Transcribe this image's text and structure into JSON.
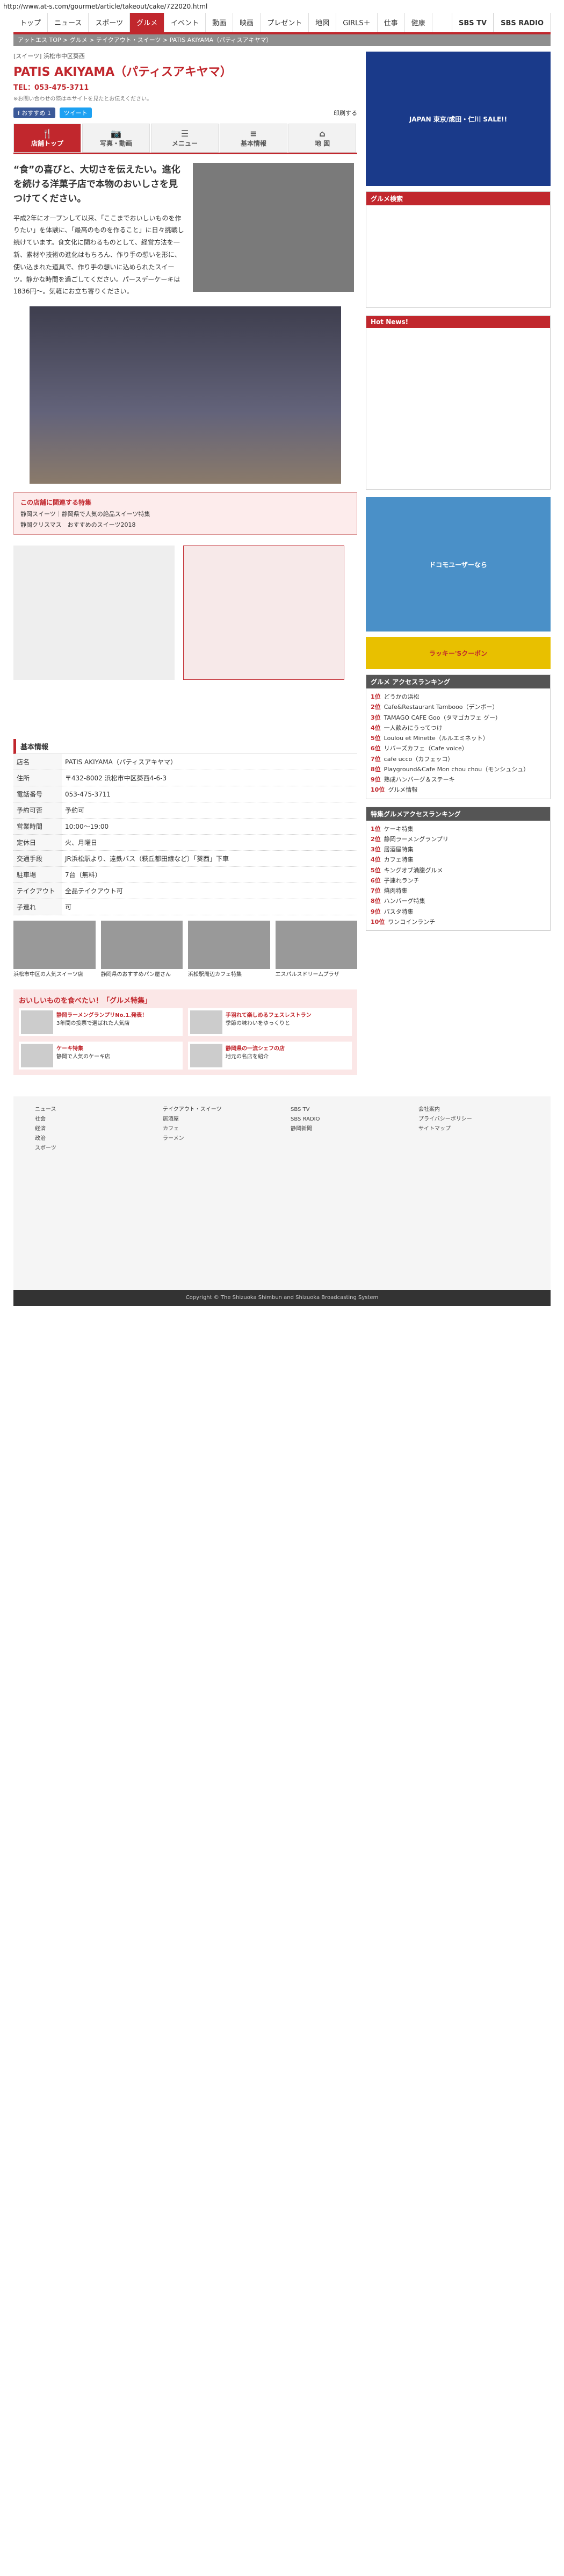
{
  "url": "http://www.at-s.com/gourmet/article/takeout/cake/722020.html",
  "nav": {
    "items": [
      "トップ",
      "ニュース",
      "スポーツ",
      "グルメ",
      "イベント",
      "動画",
      "映画",
      "プレゼント",
      "地図",
      "GIRLS＋",
      "仕事",
      "健康"
    ],
    "active": "グルメ",
    "right": [
      "SBS TV",
      "SBS RADIO"
    ]
  },
  "breadcrumb": "アットエス TOP > グルメ > テイクアウト・スイーツ > PATIS AKIYAMA（パティスアキヤマ）",
  "shop": {
    "area": "[スイーツ] 浜松市中区葵西",
    "title": "PATIS AKIYAMA（パティスアキヤマ）",
    "tel": "TEL：053-475-3711",
    "note": "※お問い合わせの際は本サイトを見たとお伝えください。"
  },
  "share": {
    "fb": "f おすすめ 1",
    "tw": "ツイート",
    "print": "印刷する"
  },
  "tabs": [
    {
      "icon": "fork",
      "label": "店舗トップ"
    },
    {
      "icon": "camera",
      "label": "写真・動画"
    },
    {
      "icon": "menu",
      "label": "メニュー"
    },
    {
      "icon": "list",
      "label": "基本情報"
    },
    {
      "icon": "map",
      "label": "地 図"
    }
  ],
  "intro": {
    "lead": "“食”の喜びと、大切さを伝えたい。進化を続ける洋菓子店で本物のおいしさを見つけてください。",
    "body": "平成2年にオープンして以来、「ここまでおいしいものを作りたい」を体験に、「最高のものを作ること」に日々挑戦し続けています。食文化に関わるものとして、経営方法を一新、素材や技術の進化はもちろん、作り手の想いを形に、使い込まれた道具で、作り手の想いに込められたスイーツ。静かな時間を過ごしてください。パースデーケーキは1836円～。気軽にお立ち寄りください。"
  },
  "related": {
    "heading": "この店舗に関連する特集",
    "links": [
      "静岡スイーツ｜静岡県で人気の絶品スイーツ特集",
      "静岡クリスマス　おすすめのスイーツ2018"
    ]
  },
  "basic": {
    "heading": "基本情報",
    "rows": [
      {
        "k": "店名",
        "v": "PATIS AKIYAMA（パティスアキヤマ）"
      },
      {
        "k": "住所",
        "v": "〒432-8002 浜松市中区葵西4-6-3"
      },
      {
        "k": "電話番号",
        "v": "053-475-3711"
      },
      {
        "k": "予約可否",
        "v": "予約可"
      },
      {
        "k": "営業時間",
        "v": "10:00～19:00"
      },
      {
        "k": "定休日",
        "v": "火、月曜日"
      },
      {
        "k": "交通手段",
        "v": "JR浜松駅より、遠鉄バス（萩丘都田線など）「葵西」下車"
      },
      {
        "k": "駐車場",
        "v": "7台（無料）"
      },
      {
        "k": "テイクアウト",
        "v": "全品テイクアウト可"
      },
      {
        "k": "子連れ",
        "v": "可"
      }
    ]
  },
  "ranking": {
    "heading": "グルメ アクセスランキング",
    "items": [
      "どうかの浜松",
      "Cafe&Restaurant Tambooo（デンボー）",
      "TAMAGO CAFE Goo（タマゴカフェ グー）",
      "一人飲みにうってつけ",
      "Loulou et Minette（ルルエミネット）",
      "リバーズカフェ（Cafe voice）",
      "cafe ucco（カフェッコ）",
      "Playground&Cafe Mon chou chou（モンシュシュ）",
      "熟成ハンバーグ＆ステーキ",
      "グルメ情報"
    ]
  },
  "ranking2": {
    "heading": "特集グルメアクセスランキング",
    "items": [
      "ケーキ特集",
      "静岡ラーメングランプリ",
      "居酒屋特集",
      "カフェ特集",
      "キングオブ満腹グルメ",
      "子連れランチ",
      "焼肉特集",
      "ハンバーグ特集",
      "パスタ特集",
      "ワンコインランチ"
    ]
  },
  "cards": [
    "浜松市中区の人気スイーツ店",
    "静岡県のおすすめパン屋さん",
    "浜松駅周辺カフェ特集",
    "エスパルスドリームプラザ"
  ],
  "osusume": {
    "heading": "おいしいものを食べたい！「グルメ特集」",
    "items": [
      {
        "t": "静岡ラーメングランプリNo.1.発表！",
        "d": "3年間の投票で選ばれた人気店"
      },
      {
        "t": "手羽れて楽しめるフェスレストラン",
        "d": "季節の味わいをゆっくりと"
      },
      {
        "t": "ケーキ特集",
        "d": "静岡で人気のケーキ店"
      },
      {
        "t": "静岡県の一流シェフの店",
        "d": "地元の名店を紹介"
      }
    ]
  },
  "footer": {
    "cols": [
      [
        "ニュース",
        "社会",
        "経済",
        "政治",
        "スポーツ"
      ],
      [
        "テイクアウト・スイーツ",
        "居酒屋",
        "カフェ",
        "ラーメン"
      ],
      [
        "SBS TV",
        "SBS RADIO",
        "静岡新聞"
      ],
      [
        "会社案内",
        "プライバシーポリシー",
        "サイトマップ"
      ]
    ],
    "copy": "Copyright © The Shizuoka Shimbun and Shizuoka Broadcasting System"
  },
  "side": {
    "search": "グルメ検索",
    "hotnews": "Hot News!",
    "banners": [
      "JAPAN 東京/成田・仁川 SALE!!",
      "ドコモユーザーなら",
      "ラッキー'Sクーポン"
    ]
  }
}
